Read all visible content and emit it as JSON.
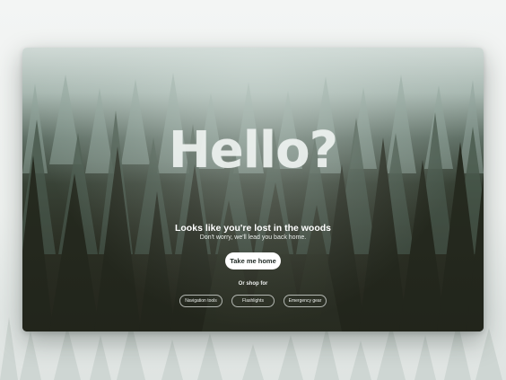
{
  "hero": {
    "headline": "Hello?",
    "title": "Looks like you're lost in the woods",
    "subtitle": "Don't worry, we'll lead you back home."
  },
  "actions": {
    "home_button": "Take me home"
  },
  "shop": {
    "label": "Or shop for",
    "chips": [
      "Navigation tools",
      "Flashlights",
      "Emergency gear"
    ]
  },
  "colors": {
    "card_button_bg": "#ffffff",
    "forest_dark": "#2a2c22",
    "fog": "#cfd9d5",
    "page_bg": "#f3f5f4"
  }
}
